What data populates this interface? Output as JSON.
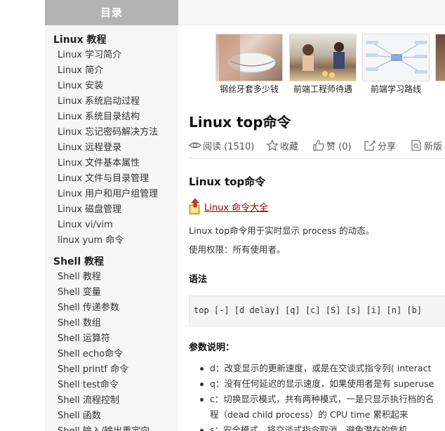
{
  "sidebar": {
    "heading": "目录",
    "sections": [
      {
        "title": "Linux 教程",
        "items": [
          "Linux 学习简介",
          "Linux 简介",
          "Linux 安装",
          "Linux 系统启动过程",
          "Linux 系统目录结构",
          "Linux 忘记密码解决方法",
          "Linux 远程登录",
          "Linux 文件基本属性",
          "Linux 文件与目录管理",
          "Linux 用户和用户组管理",
          "Linux 磁盘管理",
          "Linux vi/vim",
          "linux yum 命令"
        ]
      },
      {
        "title": "Shell 教程",
        "items": [
          "Shell 教程",
          "Shell 变量",
          "Shell 传递参数",
          "Shell 数组",
          "Shell 运算符",
          "Shell echo命令",
          "Shell printf 命令",
          "Shell test命令",
          "Shell 流程控制",
          "Shell 函数",
          "Shell 输入/输出重定向"
        ]
      }
    ]
  },
  "thumbs": [
    {
      "caption": "钢丝牙套多少钱"
    },
    {
      "caption": "前端工程师待遇"
    },
    {
      "caption": "前端学习路线"
    },
    {
      "caption": ""
    }
  ],
  "article": {
    "title": "Linux top命令",
    "meta": {
      "read": "阅读 (1510)",
      "fav": "收藏",
      "like": "赞 (0)",
      "share": "分享",
      "new": "新版"
    },
    "h2": "Linux top命令",
    "book_link": "Linux 命令大全",
    "p1": "Linux top命令用于实时显示 process 的动态。",
    "p2": "使用权限：所有使用者。",
    "syntax_heading": "语法",
    "syntax_code": "top [-] [d delay] [q] [c] [S] [s] [i] [n] [b]",
    "params_heading": "参数说明：",
    "params": [
      {
        "line1": "d：改变显示的更新速度，或是在交谈式指令列( interact",
        "line2": ""
      },
      {
        "line1": "q：没有任何延迟的显示速度，如果使用者是有 superuse",
        "line2": ""
      },
      {
        "line1": "c：切换显示模式，共有两种模式，一是只显示执行档的名",
        "line2": "程（dead child process）的 CPU time 累积起来"
      },
      {
        "line1": "s：安全模式，将交谈式指令取消，避免潜在的危机",
        "line2": ""
      }
    ]
  },
  "colors": {
    "sidebar_head_bg": "#b3b3b3",
    "sidebar_bg": "#f6f6f6",
    "link": "#990000"
  }
}
